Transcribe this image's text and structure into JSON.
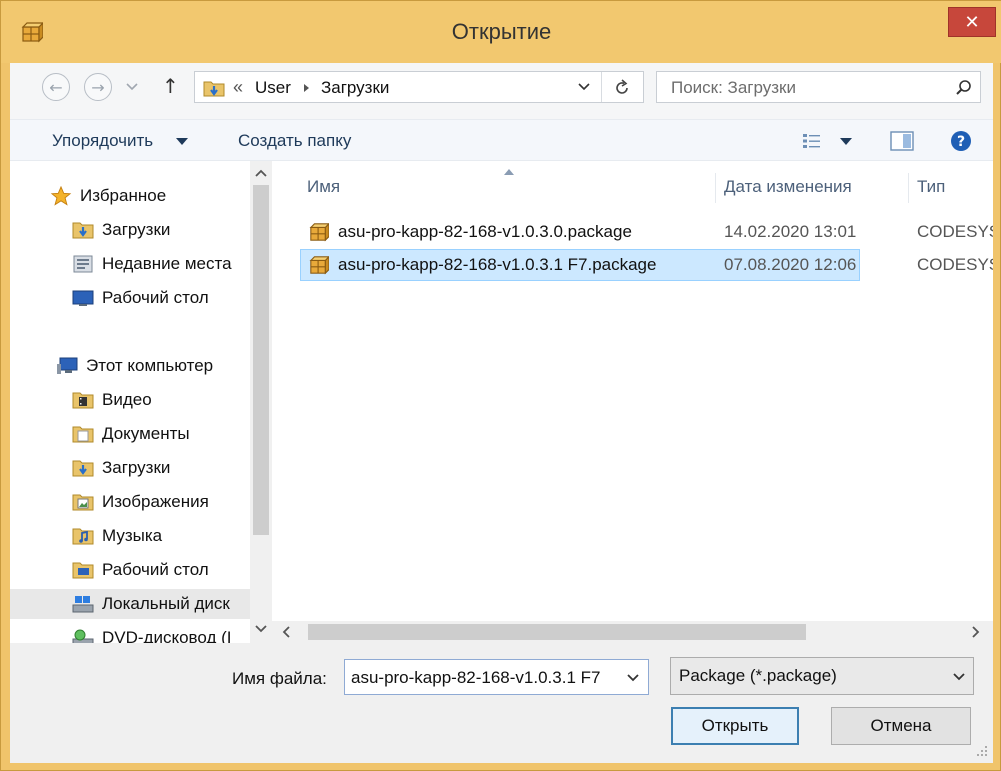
{
  "window": {
    "title": "Открытие",
    "close_glyph": "✕"
  },
  "nav": {
    "back_glyph": "←",
    "forward_glyph": "→",
    "up_glyph": "↑",
    "address_prefix": "«",
    "breadcrumb": [
      "User",
      "Загрузки"
    ],
    "search_placeholder": "Поиск: Загрузки"
  },
  "toolbar": {
    "organize": "Упорядочить",
    "new_folder": "Создать папку"
  },
  "sidebar": {
    "favorites": {
      "label": "Избранное",
      "items": [
        {
          "label": "Загрузки",
          "icon": "downloads-folder-icon"
        },
        {
          "label": "Недавние места",
          "icon": "recent-places-icon"
        },
        {
          "label": "Рабочий стол",
          "icon": "desktop-icon"
        }
      ]
    },
    "computer": {
      "label": "Этот компьютер",
      "items": [
        {
          "label": "Видео",
          "icon": "video-folder-icon"
        },
        {
          "label": "Документы",
          "icon": "documents-folder-icon"
        },
        {
          "label": "Загрузки",
          "icon": "downloads-folder-icon"
        },
        {
          "label": "Изображения",
          "icon": "pictures-folder-icon"
        },
        {
          "label": "Музыка",
          "icon": "music-folder-icon"
        },
        {
          "label": "Рабочий стол",
          "icon": "desktop-folder-icon"
        },
        {
          "label": "Локальный диск",
          "icon": "local-disk-icon"
        },
        {
          "label": "DVD-дисковод (I",
          "icon": "dvd-drive-icon"
        }
      ]
    }
  },
  "files": {
    "columns": [
      "Имя",
      "Дата изменения",
      "Тип"
    ],
    "rows": [
      {
        "name": "asu-pro-kapp-82-168-v1.0.3.0.package",
        "date": "14.02.2020 13:01",
        "type": "CODESYS"
      },
      {
        "name": "asu-pro-kapp-82-168-v1.0.3.1 F7.package",
        "date": "07.08.2020 12:06",
        "type": "CODESYS"
      }
    ]
  },
  "footer": {
    "filename_label": "Имя файла:",
    "filename_value": "asu-pro-kapp-82-168-v1.0.3.1 F7",
    "filetype_value": "Package (*.package)",
    "open_button": "Открыть",
    "cancel_button": "Отмена"
  },
  "colors": {
    "title_bar": "#f2c86f",
    "close_button": "#c7473b",
    "selection": "#cce8ff"
  }
}
